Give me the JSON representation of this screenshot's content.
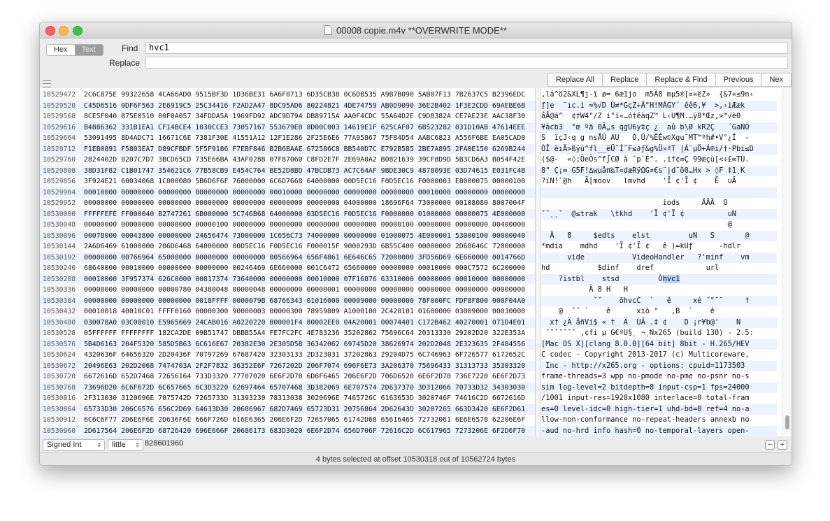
{
  "window": {
    "title": "00008 copie.m4v **OVERWRITE MODE**"
  },
  "find": {
    "mode_hex": "Hex",
    "mode_text": "Text",
    "find_label": "Find",
    "find_value": "hvc1",
    "replace_label": "Replace",
    "replace_value": ""
  },
  "buttons": {
    "replace_all": "Replace All",
    "replace": "Replace",
    "replace_find": "Replace & Find",
    "previous": "Previous",
    "next": "Nex"
  },
  "rows": [
    {
      "n": "10529472",
      "h": "2C6C875E 99322658 4CA66AD0 9515BF3D 1D36BE31 6A6F0713 6D35CB38 0C6DB535 A9B7B090 5AB07F13 7B2637C5 B2396EDC",
      "t": ",lá^ö2&XL¶j-ï ø= 6æ1jo  m5À8 mµ5®[¤«ëZ»  {&7«≤9n‹"
    },
    {
      "n": "10529520",
      "h": "C45D6516 0DF6F563 2E6919C5 25C34416 F2AD2A47 8DC95AD6 80224821 4DE74759 AB0D9090 36E2B402 1F3E2CDD 69AEBE6B",
      "t": "ƒ]e  ¯ıc.i ≈%√D Û≠*GçZ÷Ä\"H!MÁGY´ êê6,¥  >,›iÆæk"
    },
    {
      "n": "10529568",
      "h": "8CE5F040 875E0510 00F0A057 34FDDA5A 1969FD92 ADC9D794 DB89715A AA0F4CDC 55A64D2E C9D8382A CE7AE23E AAC38F30",
      "t": "åÂ@á^  ¢†W4\"/Z i\"í«…ó†éàqZ™ L‹U¶M.…ÿ8*Œz‚>™√è0"
    },
    {
      "n": "10529616",
      "h": "B4886362 331B1EA1 CF14BCE4 1030CCE3 73057167 553679E0 8D00C003 14619E1F 625CAF07 6B523282 031D10AB 47614EEE",
      "t": "¥àcb3  °œ ºä 0Ã„s qgU6y‡ç ¿  aû b\\Ø kR2Ç   ´GaNÓ"
    },
    {
      "n": "10529664",
      "h": "53091495 8D4ADC71 16671C6E 7381F30E 41551A12 12F1E286 2F25E6E6 77A95867 75F84D54 AABC6823 A556F6BE EA05CAD0",
      "t": "S  ïçJ‹q g nsÅÛ AU   Ò,Û/%ÊÊw©Xgu¯MT™ºh#•V°¿Í  -"
    },
    {
      "n": "10529712",
      "h": "F1EB0891 F5803EA7 D89CFBDF 5F5F9186 F7EBF846 B2B6BAAE 672586C8 BB540D7C E792B585 2BE7A895 2FA0E150 6269B244",
      "t": "ÒÎ ëıÄ>ßÿú^fl__ëÜ˜Í˜F≤∂ƒ&g%Ü»ªT |Á¨µÖ+Á®i/†·Pbi≤D"
    },
    {
      "n": "10529760",
      "h": "2824402D 0207C7D7 3BCD65CD 735E66BA 43AF0288 07F87060 C8FD2E7F 2E69A0A2 B0821639 39CF8D9D 5B3CD6A3 B054F42E",
      "t": "($@-  «◊;ÕeÕs^f∫CØ à ˇp`È\". .i†¢∞Ç 99œçù[<÷£∞TÙ."
    },
    {
      "n": "10529808",
      "h": "38D31F82 C1B01747 354621C6 77B58CB9 E454C764 BE52D8BD 47BCDB73 AC7C64AF 9BDE30C9 4878093E 03D74615 E031FC4B",
      "t": "8\" Ç¡∞ G5F!∆wµåπ‰T«dæRÿΩG¤€s¨|d¯õ0…Hx > ◊F ‡1¸K"
    },
    {
      "n": "10529856",
      "h": "3F924E21 60034068 1C000080 5B6D6F6F 76000000 6C6D7668 64000000 00D5EC16 F0D5EC16 F0000003 E8000075 00000100",
      "t": "?íN!`@h   Ä[moov   lmvhd    'Ï ¢'Ï ¢    Ë  uÄ"
    },
    {
      "n": "10529904",
      "h": "00010000 00000000 00000000 00000000 00000000 00010000 00000000 00000000 00000000 00010000 00000000 00000000",
      "t": "                                          "
    },
    {
      "n": "10529952",
      "h": "00000000 00000000 00000000 00000000 00000000 00000000 00000000 04000000 18696F64 73000000 00108080 8007004F",
      "t": "                            iods     ÄÄÄ  O"
    },
    {
      "n": "10530000",
      "h": "FFFFFEFE FF000040 B2747261 6B000000 5C746B68 64000000 03D5EC16 F0D5EC16 F0000000 01000000 00000075 4E000000",
      "t": "ˇˇ˛˛ˇ  @≤trak   \\tkhd    'Ï ¢'Ï ¢          uN"
    },
    {
      "n": "10530048",
      "h": "00000000 00000000 00000000 00000100 00000000 00000000 00000000 00000000 00000100 00000000 00000000 00400000",
      "t": "                                           @"
    },
    {
      "n": "10530096",
      "h": "00078000 00043800 00000000 24656474 73000000 1C656C73 74000000 00000000 01000075 4E000001 53000100 00000040",
      "t": "  Ä   8     $edts    elst         uN   S       @"
    },
    {
      "n": "10530144",
      "h": "2A6D6469 61000000 206D6468 64000000 00D5EC16 F0D5EC16 F000015F 9000293D 6B55C400 00000000 2D68646C 72000000",
      "t": "*mdia    mdhd    'Ï ¢'Ï ¢  _ê )=kUƒ      -hdlr"
    },
    {
      "n": "10530192",
      "h": "00000000 00766964 65000000 00000000 00000000 00566964 656F4861 6E646C65 72000000 3FD56D69 6E660000 0014766D",
      "t": "      vide           VideoHandler   ?'minf    vm"
    },
    {
      "n": "10530240",
      "h": "68640000 00010000 00000000 00000000 00246469 6E660000 001C6472 65660000 00000000 00010000 000C7572 6C200000",
      "t": "hd           $dinf    dref            url"
    },
    {
      "n": "10530288",
      "h": "00010000 3F957374 626C0000 00817374 73640000 00000000 00010000 07F16876 63310000 00000000 00010000 00000000",
      "t": "    ?ïstbl    stsd         Òhvc1"
    },
    {
      "n": "10530336",
      "h": "00000000 00000000 00000780 04380048 00000048 00000000 00000001 00000000 00000000 00000000 00000000 00000000",
      "t": "           Ä 8 H   H"
    },
    {
      "n": "10530384",
      "h": "00000000 00000000 00000000 0018FFFF 0000079B 68766343 01016000 00009000 00000000 78F000FC FDF8F800 000F04A0",
      "t": "            ˇˇ    õhvcC  `   ê     xé ˝\"¯¯     †"
    },
    {
      "n": "10530432",
      "h": "00010018 40010C01 FFFF0160 00000300 90000003 00000300 78959809 A1000100 2C420101 01600000 03009000 00030000",
      "t": "    @  ˇˇ `    ê      xïò °   ,B  `    ê"
    },
    {
      "n": "10530480",
      "h": "030078A0 03C08010 E5965669 24CAB016 A0220220 800001F4 80002EE0 04A20001 00074401 C172B462 40270001 071D4E01",
      "t": "  x† ¿Ä åñVi$ « †  Ä  ÙÄ .‡ ¢    D ¡r¥b@'    N"
    },
    {
      "n": "10530528",
      "h": "05FFFFFF FFFFFFFF 182CA2DE 09B51747 DBBB55A4 FE7FC2FC 4E783236 35202862 75696C64 20313330 29202D20 322E353A",
      "t": " ˇˇˇˇˇˇˇ ,¢fi µ G€ªU§˛ ¬˛Nx265 (build 130) - 2.5:"
    },
    {
      "n": "10530576",
      "h": "5B4D6163 204F5320 585D5B63 6C616E67 20382E30 2E305D5B 36342062 69745D20 38626974 202D2048 2E323635 2F484556",
      "t": "[Mac OS X][clang 8.0.0][64 bit] 8bit - H.265/HEV"
    },
    {
      "n": "10530624",
      "h": "4320636F 64656320 2D20436F 70797269 67687420 32303133 2D323031 37202863 29204D75 6C746963 6F726577 6172652C",
      "t": "C codec - Copyright 2013-2017 (c) Multicoreware,"
    },
    {
      "n": "10530672",
      "h": "20496E63 202D2068 7474703A 2F2F7832 36352E6F 7267202D 206F7074 696F6E73 3A206370 75696433 31313733 35303320",
      "t": " Inc - http://x265.org - options: cpuid=1173503"
    },
    {
      "n": "10530720",
      "h": "6672616D 652D7468 72656164 733D3320 77707020 6E6F2D70 6D6F6465 206E6F2D 706D6520 6E6F2D70 736E7220 6E6F2D73",
      "t": "frame-threads=3 wpp no-pmode no-pme no-psnr no-s"
    },
    {
      "n": "10530768",
      "h": "73696D20 6C6F672D 6C657665 6C3D3220 62697464 65707468 3D382069 6E707574 2D637370 3D312066 70733D32 34303030",
      "t": "sim log-level=2 bitdepth=8 input-csp=1 fps=24000"
    },
    {
      "n": "10530816",
      "h": "2F313030 3120696E 7075742D 7265733D 31393230 78313038 3020696E 7465726C 6163653D 3020746F 74616C2D 6672616D",
      "t": "/1001 input-res=1920x1080 interlace=0 total-fram"
    },
    {
      "n": "10530864",
      "h": "65733D30 206C6576 656C2D69 64633D30 20686967 682D7469 65723D31 20756864 2D62643D 30207265 663D3420 6E6F2D61",
      "t": "es=0 level-idc=0 high-tier=1 uhd-bd=0 ref=4 no-a"
    },
    {
      "n": "10530912",
      "h": "6C6C6F77 2D6E6F6E 2D636F6E 666F726D 616E6365 206E6F2D 72657065 61742D68 65616465 72732061 6E6E6578 62206E6F",
      "t": "llow-non-conformance no-repeat-headers annexb no"
    },
    {
      "n": "10530960",
      "h": "2D617564 206E6F2D 68726420 696E666F 20686173 683D3020 6E6F2D74 656D706F 72616C2D 6C617965 7273206E 6F2D6F70",
      "t": "-aud no-hrd info hash=0 no-temporal-layers open-"
    },
    {
      "n": "10531008",
      "h": "676F7020 6D696E2D 6B657969 6E743D32 34206B65 79696E74 3D323430 20626672 616D6573 3D342062 2D616461 70743D32",
      "t": "gop min-keyint=24 keyint=240 bframes=4 b-adapt=2"
    },
    {
      "n": "10531056",
      "h": "20622D70 79726164 69642062 6672616D 652D6269 61733D30 2072632D 6C6F6F6B 61686561 643D3235 206C6F6F 6B616865",
      "t": " b-pyramid bframe-bias=0 rc-lookahead=25 lookahe"
    },
    {
      "n": "10531104",
      "h": "61642D73 6C696365 733D3420 7363656E 65637574 3D343020 6E6F2D69 6E747261 2D726566 72657368 20637475 3D363420",
      "t": "ad-slices=4 scenecut=40 no-intra-refresh ctu=64"
    }
  ],
  "highlight": {
    "row": 17,
    "text": "hvc1"
  },
  "bottom": {
    "type_value": "Signed Int",
    "endian_value": "little",
    "int_value": "828601960",
    "minus": "−",
    "plus": "+"
  },
  "status": "4 bytes selected at offset 10530318 out of 10562724 bytes"
}
